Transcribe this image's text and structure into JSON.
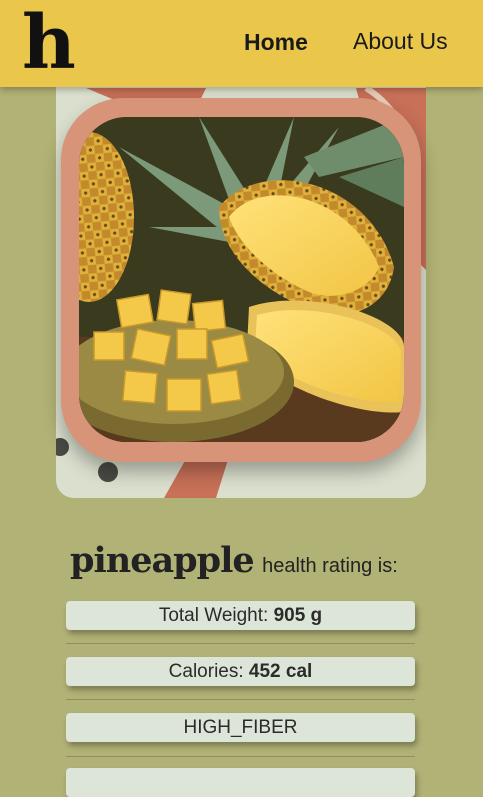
{
  "header": {
    "logo": "h",
    "nav": {
      "home": "Home",
      "about": "About Us"
    }
  },
  "colors": {
    "header_bg": "#eac74a",
    "page_bg": "#b1b275",
    "card_bg": "#dbe0ce",
    "frame": "#d79479",
    "stat_bg": "#dde5d8"
  },
  "image": {
    "subject": "pineapple photo"
  },
  "rating": {
    "fruit": "pineapple",
    "label": "health rating is:"
  },
  "stats": [
    {
      "label": "Total Weight: ",
      "value": "905 g"
    },
    {
      "label": "Calories: ",
      "value": "452 cal"
    },
    {
      "label": "HIGH_FIBER",
      "value": ""
    },
    {
      "label": "",
      "value": ""
    }
  ]
}
